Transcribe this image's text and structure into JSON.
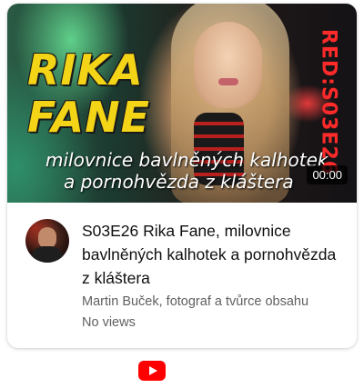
{
  "thumbnail": {
    "name_line1": "RIKA",
    "name_line2": "FANE",
    "subtitle_line1": "milovnice bavlněných kalhotek",
    "subtitle_line2": "a pornohvězda z kláštera",
    "side_label": "RED:S03E26",
    "duration": "00:00",
    "colors": {
      "name": "#f3d417",
      "side_label": "#ff2a2a"
    }
  },
  "video": {
    "title": "S03E26 Rika Fane, milovnice bavlněných kalhotek a pornohvězda z kláštera",
    "channel": "Martin Buček, fotograf a tvůrce obsahu",
    "views": "No views"
  },
  "footer": {
    "logo_icon": "youtube-logo-icon",
    "logo_color": "#ff0000"
  }
}
